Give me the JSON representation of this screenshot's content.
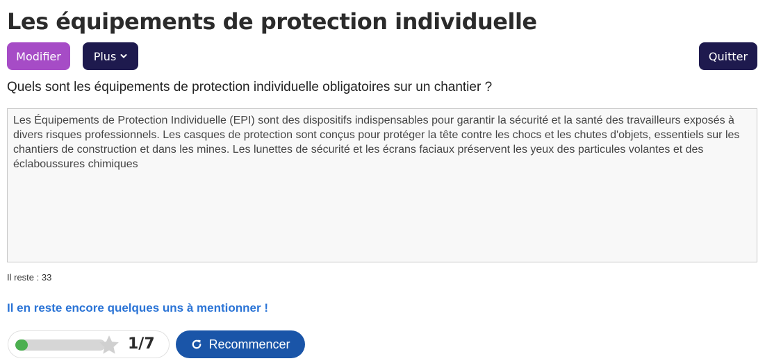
{
  "page": {
    "title": "Les équipements de protection individuelle"
  },
  "toolbar": {
    "modifier_label": "Modifier",
    "plus_label": "Plus",
    "quitter_label": "Quitter"
  },
  "question": {
    "text": "Quels sont les équipements de protection individuelle obligatoires sur un chantier ?"
  },
  "answer": {
    "value": "Les Équipements de Protection Individuelle (EPI) sont des dispositifs indispensables pour garantir la sécurité et la santé des travailleurs exposés à divers risques professionnels. Les casques de protection sont conçus pour protéger la tête contre les chocs et les chutes d'objets, essentiels sur les chantiers de construction et dans les mines. Les lunettes de sécurité et les écrans faciaux préservent les yeux des particules volantes et des éclaboussures chimiques"
  },
  "remaining": {
    "text": "Il reste : 33"
  },
  "feedback": {
    "hint": "Il en reste encore quelques uns à mentionner !"
  },
  "progress": {
    "current": 1,
    "total": 7,
    "label": "1/7",
    "fill_fraction": 0.14
  },
  "actions": {
    "restart_label": "Recommencer"
  },
  "colors": {
    "modifier": "#a64cc6",
    "dark_button": "#1e1a4e",
    "hint": "#2b74d6",
    "restart": "#1a55a8",
    "progress_fill": "#4caf50"
  },
  "icons": {
    "plus_dropdown": "chevron-down-icon",
    "progress": "star-icon",
    "restart": "refresh-icon"
  }
}
